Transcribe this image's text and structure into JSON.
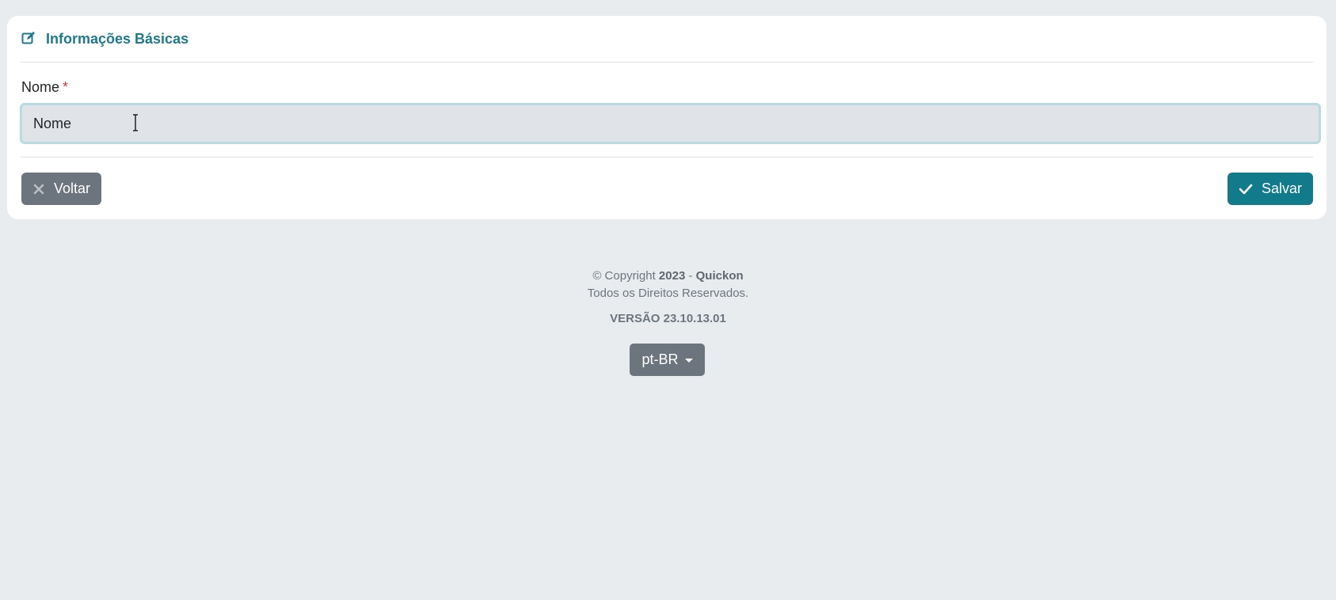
{
  "card": {
    "title": "Informações Básicas",
    "field": {
      "label": "Nome",
      "required_mark": "*",
      "value": "Nome",
      "placeholder": "Nome"
    },
    "back_label": "Voltar",
    "save_label": "Salvar"
  },
  "footer": {
    "copyright_prefix": "© Copyright",
    "year": "2023",
    "separator": "-",
    "company": "Quickon",
    "rights": "Todos os Direitos Reservados.",
    "version": "VERSÃO 23.10.13.01",
    "language": "pt-BR"
  },
  "colors": {
    "accent": "#1c7a8c",
    "save_button": "#117a8b",
    "secondary_button": "#6c757d",
    "required": "#dc3545",
    "background": "#e9ecef"
  },
  "icons": {
    "title": "edit-icon",
    "back": "close-icon",
    "save": "check-icon",
    "language": "caret-down-icon"
  }
}
